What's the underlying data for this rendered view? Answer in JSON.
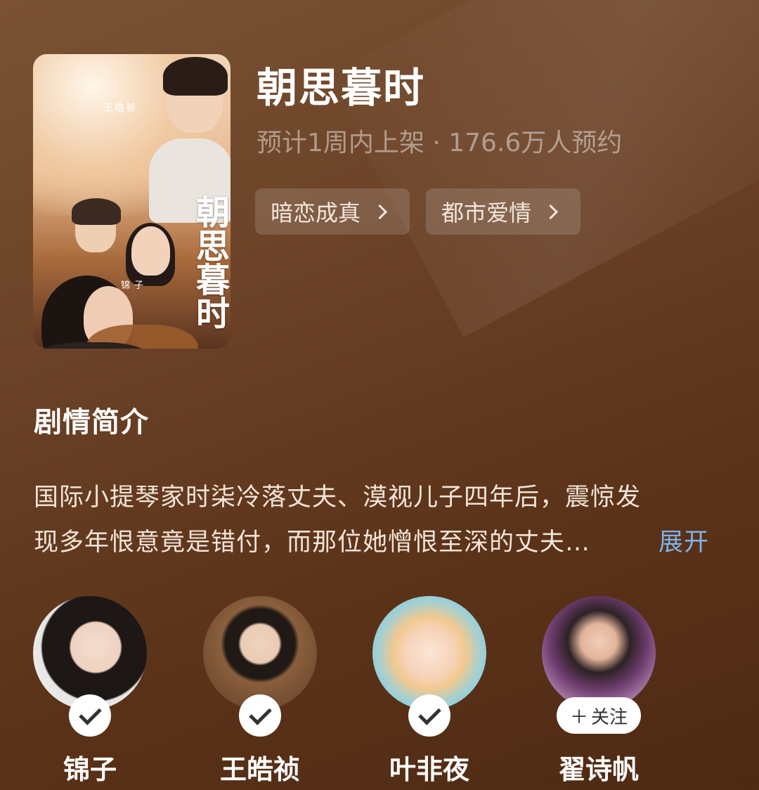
{
  "drama": {
    "title": "朝思暮时",
    "meta": "预计1周内上架 · 176.6万人预约",
    "tags": [
      {
        "label": "暗恋成真"
      },
      {
        "label": "都市爱情"
      }
    ]
  },
  "poster": {
    "cast_top": "王皓祯",
    "cast_bottom": "锦子",
    "calligraphy_title": "朝思暮时"
  },
  "synopsis": {
    "heading": "剧情简介",
    "line1": "国际小提琴家时柒冷落丈夫、漠视儿子四年后，震惊发",
    "line2": "现多年恨意竟是错付，而那位她憎恨至深的丈夫…",
    "expand_label": "展开"
  },
  "cast": [
    {
      "name": "锦子",
      "status": "followed"
    },
    {
      "name": "王皓祯",
      "status": "followed"
    },
    {
      "name": "叶非夜",
      "status": "followed"
    },
    {
      "name": "翟诗帆",
      "status": "not_followed",
      "follow_label": "关注"
    }
  ],
  "colors": {
    "background_top": "#7a5233",
    "background_bottom": "#4e2a13",
    "link": "#7fb2ea"
  }
}
